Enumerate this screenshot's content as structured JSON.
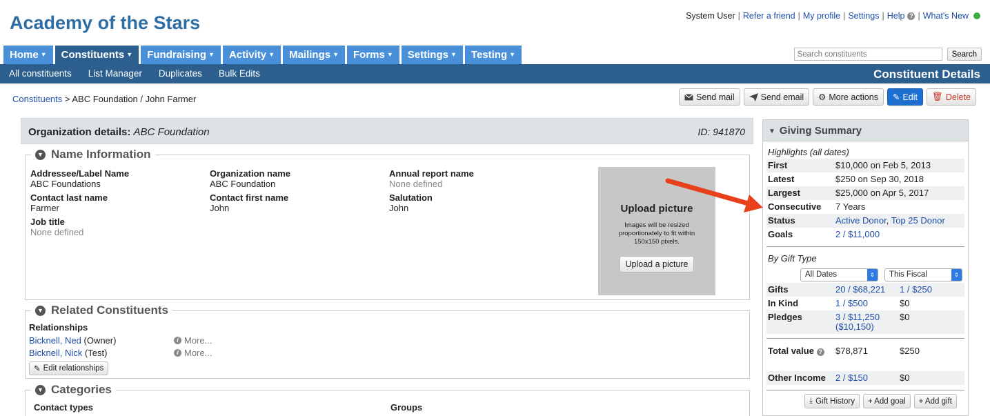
{
  "app": {
    "title": "Academy of the Stars"
  },
  "toplinks": {
    "user": "System User",
    "items": [
      "Refer a friend",
      "My profile",
      "Settings",
      "Help",
      "What's New"
    ]
  },
  "nav": {
    "tabs": [
      "Home",
      "Constituents",
      "Fundraising",
      "Activity",
      "Mailings",
      "Forms",
      "Settings",
      "Testing"
    ],
    "active": "Constituents"
  },
  "search": {
    "placeholder": "Search constituents",
    "button": "Search"
  },
  "subnav": {
    "items": [
      "All constituents",
      "List Manager",
      "Duplicates",
      "Bulk Edits"
    ],
    "page_heading": "Constituent Details"
  },
  "breadcrumb": {
    "root": "Constituents",
    "separator": ">",
    "current": "ABC Foundation / John Farmer"
  },
  "actions": {
    "send_mail": "Send mail",
    "send_email": "Send email",
    "more_actions": "More actions",
    "edit": "Edit",
    "delete": "Delete"
  },
  "org": {
    "label": "Organization details:",
    "name": "ABC Foundation",
    "id": "ID: 941870"
  },
  "name_info": {
    "title": "Name Information",
    "fields": {
      "addressee_label": "Addressee/Label Name",
      "addressee_value": "ABC Foundations",
      "org_name_label": "Organization name",
      "org_name_value": "ABC Foundation",
      "annual_label": "Annual report name",
      "annual_value": "None defined",
      "contact_last_label": "Contact last name",
      "contact_last_value": "Farmer",
      "contact_first_label": "Contact first name",
      "contact_first_value": "John",
      "salutation_label": "Salutation",
      "salutation_value": "John",
      "job_title_label": "Job title",
      "job_title_value": "None defined"
    },
    "upload": {
      "title": "Upload picture",
      "desc": "Images will be resized proportionately to fit within 150x150 pixels.",
      "button": "Upload a picture"
    }
  },
  "related": {
    "title": "Related Constituents",
    "heading": "Relationships",
    "rows": [
      {
        "name": "Bicknell, Ned",
        "role": "(Owner)",
        "more": "More..."
      },
      {
        "name": "Bicknell, Nick",
        "role": "(Test)",
        "more": "More..."
      }
    ],
    "edit_button": "Edit relationships"
  },
  "categories": {
    "title": "Categories",
    "contact_types_label": "Contact types",
    "groups_label": "Groups"
  },
  "giving": {
    "title": "Giving Summary",
    "highlights_label": "Highlights (all dates)",
    "first_label": "First",
    "first_value": "$10,000 on Feb 5, 2013",
    "latest_label": "Latest",
    "latest_value": "$250 on Sep 30, 2018",
    "largest_label": "Largest",
    "largest_value": "$25,000 on Apr 5, 2017",
    "consecutive_label": "Consecutive",
    "consecutive_value": "7 Years",
    "status_label": "Status",
    "status_1": "Active Donor",
    "status_sep": ",",
    "status_2": "Top 25 Donor",
    "goals_label": "Goals",
    "goals_value": "2 / $11,000",
    "by_gift_type_label": "By Gift Type",
    "select_1": "All Dates",
    "select_2": "This Fiscal",
    "gifts_label": "Gifts",
    "gifts_all": "20 / $68,221",
    "gifts_fiscal": "1 / $250",
    "inkind_label": "In Kind",
    "inkind_all": "1 / $500",
    "inkind_fiscal": "$0",
    "pledges_label": "Pledges",
    "pledges_all": "3 / $11,250",
    "pledges_all_2": "($10,150)",
    "pledges_fiscal": "$0",
    "total_label": "Total value",
    "total_all": "$78,871",
    "total_fiscal": "$250",
    "other_label": "Other Income",
    "other_all": "2 / $150",
    "other_fiscal": "$0",
    "btn_history": "Gift History",
    "btn_goal": "+ Add goal",
    "btn_gift": "+ Add gift"
  },
  "colors": {
    "brand_title": "#2e6da4",
    "nav_tab": "#4a90d9",
    "nav_active": "#2c5f8e",
    "primary_button": "#1f6fd1",
    "annotation_arrow": "#e8401c"
  }
}
